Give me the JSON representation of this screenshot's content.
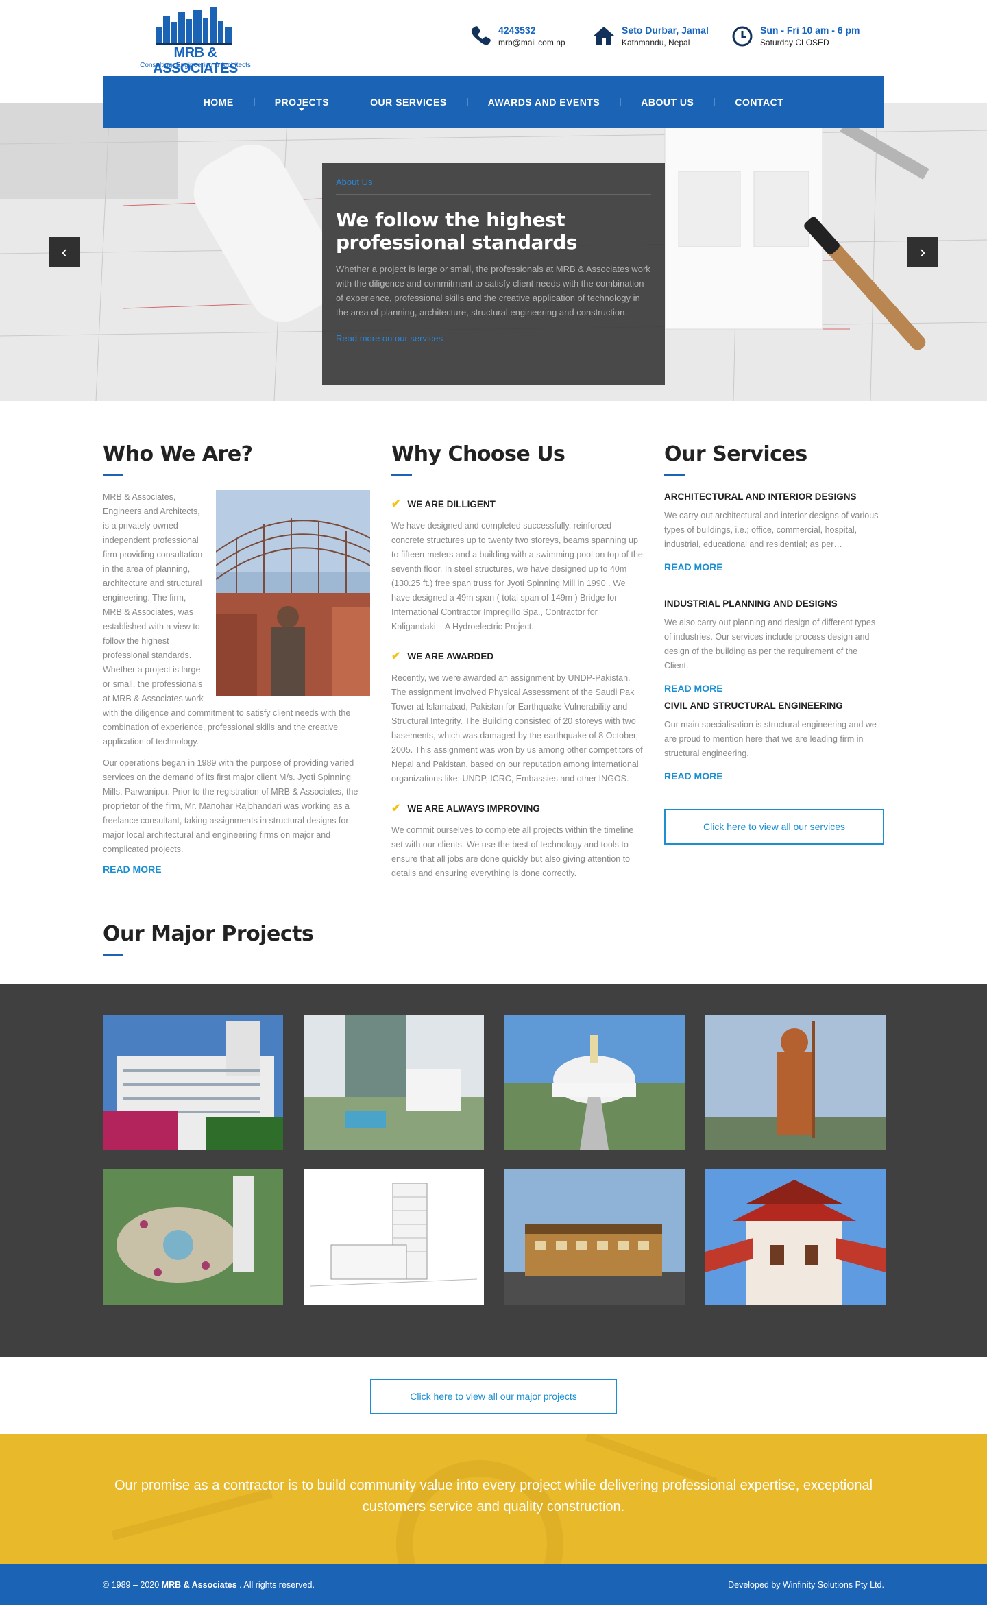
{
  "header": {
    "logo_name": "MRB & ASSOCIATES",
    "logo_tagline": "Consulting, Engineering & Architects",
    "phone": "4243532",
    "email": "mrb@mail.com.np",
    "address_line1": "Seto Durbar, Jamal",
    "address_line2": "Kathmandu, Nepal",
    "hours_line1": "Sun - Fri 10 am - 6 pm",
    "hours_line2": "Saturday CLOSED"
  },
  "nav": {
    "items": [
      "HOME",
      "PROJECTS",
      "OUR SERVICES",
      "AWARDS AND EVENTS",
      "ABOUT US",
      "CONTACT"
    ]
  },
  "hero": {
    "kicker": "About Us",
    "title": "We follow the highest professional standards",
    "body": "Whether a project is large or small, the professionals at MRB & Associates work with the diligence and commitment to satisfy client needs with the combination of experience, professional skills and the creative application of technology in the area of planning, architecture, structural engineering and construction.",
    "link": "Read more on our services",
    "prev": "‹",
    "next": "›"
  },
  "who": {
    "title": "Who We Are?",
    "p1": "MRB & Associates, Engineers and Architects, is a privately owned independent professional firm providing consultation in the area of planning, architecture and structural engineering. The firm, MRB & Associates, was established with a view to follow the highest professional standards. Whether a project is large or small, the professionals at MRB & Associates work with the diligence and commitment to satisfy client needs with the combination of experience, professional skills and the creative application of technology.",
    "p2": "Our operations began in 1989 with the purpose of providing varied services on the demand of its first major client M/s. Jyoti Spinning Mills, Parwanipur. Prior to the registration of MRB & Associates, the proprietor of the firm, Mr. Manohar Rajbhandari was working as a freelance consultant, taking assignments in structural designs for major local architectural and engineering firms on major and complicated projects.",
    "readmore": "READ MORE"
  },
  "why": {
    "title": "Why Choose Us",
    "items": [
      {
        "heading": "WE ARE DILLIGENT",
        "text": "We have designed and completed successfully, reinforced concrete structures up to twenty two storeys, beams spanning up to fifteen-meters and a building with a swimming pool on top of the seventh floor. In steel structures, we have designed up to 40m (130.25 ft.) free span truss for Jyoti Spinning Mill in 1990 . We have designed a 49m span ( total span of 149m ) Bridge for International Contractor Impregillo Spa., Contractor for Kaligandaki – A Hydroelectric Project."
      },
      {
        "heading": "WE ARE AWARDED",
        "text": "Recently, we were awarded an assignment by UNDP-Pakistan. The assignment involved Physical Assessment of the Saudi Pak Tower at Islamabad, Pakistan for Earthquake Vulnerability and Structural Integrity. The Building consisted of 20 storeys with two basements, which was damaged by the earthquake of 8 October, 2005. This assignment was won by us among other competitors of Nepal and Pakistan, based on our reputation among international organizations like; UNDP, ICRC, Embassies and other INGOS."
      },
      {
        "heading": "WE ARE ALWAYS IMPROVING",
        "text": "We commit ourselves to complete all projects within the timeline set with our clients. We use the best of technology and tools to ensure that all jobs are done quickly but also giving attention to details and ensuring everything is done correctly."
      }
    ]
  },
  "services": {
    "title": "Our Services",
    "items": [
      {
        "heading": "ARCHITECTURAL AND INTERIOR DESIGNS",
        "text": "We carry out architectural and interior designs of various types of buildings, i.e.; office, commercial, hospital, industrial, educational and residential; as per…",
        "readmore": "READ MORE"
      },
      {
        "heading": "INDUSTRIAL PLANNING AND DESIGNS",
        "text": "We also carry out planning and design of different types of industries. Our services include process design and design of the building as per the requirement of the Client.",
        "readmore": "READ MORE"
      },
      {
        "heading": "CIVIL AND STRUCTURAL ENGINEERING",
        "text": "Our main specialisation is structural engineering and we are proud to mention here that we are leading firm in structural engineering.",
        "readmore": "READ MORE"
      }
    ],
    "cta": "Click here to view all our services"
  },
  "projects": {
    "title": "Our Major Projects",
    "cta": "Click here to view all our major projects"
  },
  "promise": "Our promise as a contractor is to build community value into every project while delivering professional expertise, exceptional customers service and quality construction.",
  "footer": {
    "copy_prefix": "© 1989 – 2020 ",
    "copy_brand": "MRB & Associates",
    "copy_suffix": " . All rights reserved.",
    "developer": "Developed by Winfinity Solutions Pty Ltd."
  }
}
